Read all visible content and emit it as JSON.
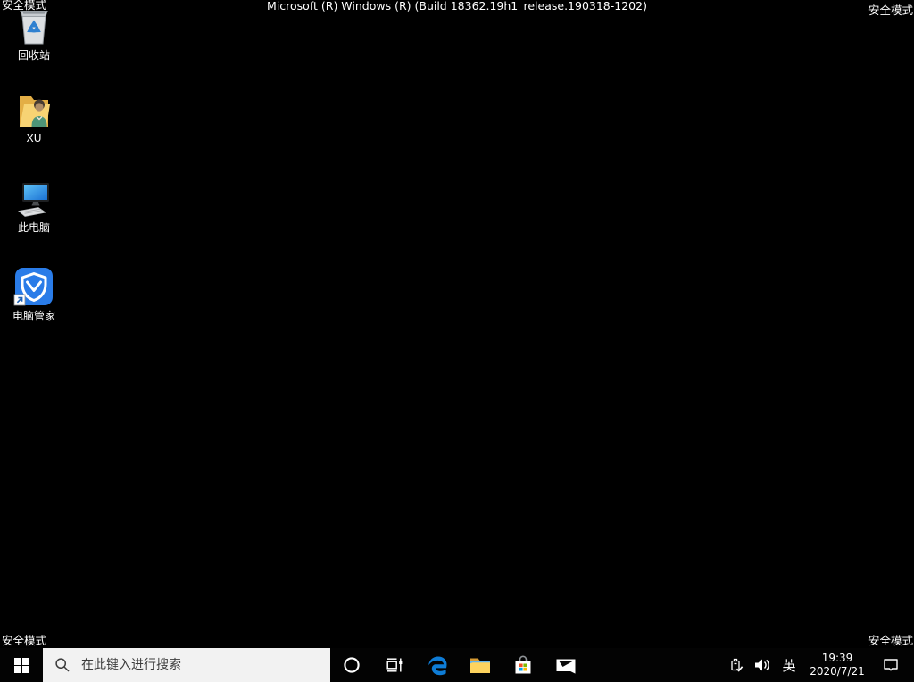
{
  "corners": {
    "top_left": "安全模式",
    "top_right": "安全模式",
    "bottom_left": "安全模式",
    "bottom_right": "安全模式"
  },
  "build_banner": "Microsoft (R) Windows (R) (Build 18362.19h1_release.190318-1202)",
  "desktop_icons": [
    {
      "name": "recycle-bin",
      "label": "回收站"
    },
    {
      "name": "user-files-folder",
      "label": "XU"
    },
    {
      "name": "this-pc",
      "label": "此电脑"
    },
    {
      "name": "pc-manager",
      "label": "电脑管家"
    }
  ],
  "taskbar": {
    "start_button": "start",
    "search": {
      "placeholder": "在此键入进行搜索"
    },
    "buttons": [
      "cortana",
      "task-view",
      "edge",
      "file-explorer",
      "store",
      "mail"
    ],
    "tray": {
      "icons": [
        "usb-safely-remove",
        "volume",
        "action-center"
      ],
      "input_method": "英",
      "clock": {
        "time": "19:39",
        "date": "2020/7/21"
      }
    }
  },
  "colors": {
    "desktop_bg": "#000000",
    "taskbar_bg": "#030303",
    "search_bg": "#f2f2f2",
    "search_text": "#3c3c3c",
    "label_text": "#ffffff",
    "edge_blue": "#0e7cd6",
    "folder_yellow": "#fdd35e",
    "folder_dark": "#d79b33",
    "pc_manager_blue": "#2a7ce8",
    "recycle_symbol_blue": "#2f80d0",
    "screen_blue": "#2ea3f2",
    "store_red": "#f25022",
    "store_green": "#7fba00",
    "store_blue": "#00a4ef",
    "store_yellow": "#ffb900"
  }
}
